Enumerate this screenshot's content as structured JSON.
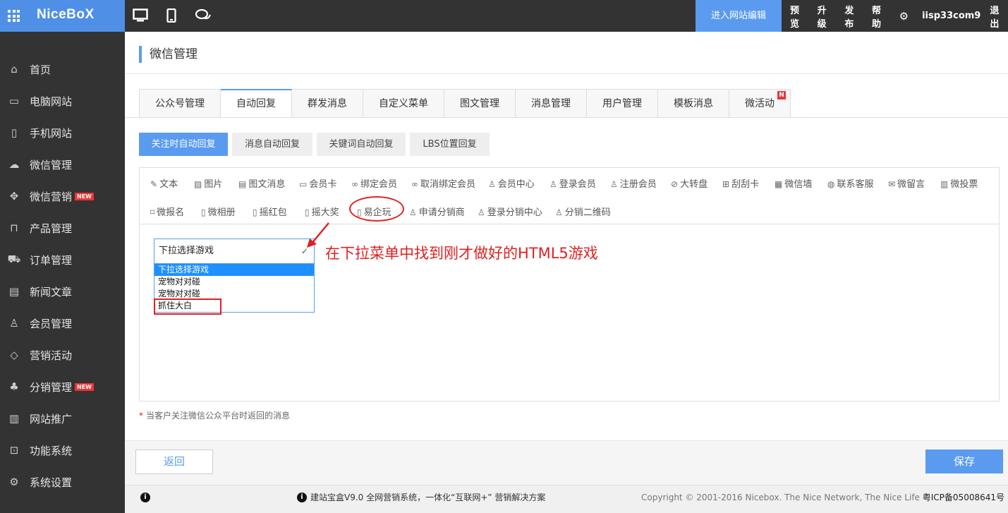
{
  "topbar": {
    "logo": "NiceBoX",
    "enter_edit": "进入网站编辑",
    "menu": [
      "预览",
      "升级",
      "发布",
      "帮助"
    ],
    "username": "iisp33com9",
    "logout": "退出"
  },
  "sidebar": {
    "items": [
      {
        "label": "首页",
        "icon": "home-icon"
      },
      {
        "label": "电脑网站",
        "icon": "monitor-icon"
      },
      {
        "label": "手机网站",
        "icon": "mobile-icon"
      },
      {
        "label": "微信管理",
        "icon": "chat-icon"
      },
      {
        "label": "微信营销",
        "icon": "gamepad-icon",
        "badge": "NEW"
      },
      {
        "label": "产品管理",
        "icon": "bag-icon"
      },
      {
        "label": "订单管理",
        "icon": "cart-icon"
      },
      {
        "label": "新闻文章",
        "icon": "document-icon"
      },
      {
        "label": "会员管理",
        "icon": "user-icon"
      },
      {
        "label": "营销活动",
        "icon": "tag-icon"
      },
      {
        "label": "分销管理",
        "icon": "sitemap-icon",
        "badge": "NEW"
      },
      {
        "label": "网站推广",
        "icon": "bar-chart-icon"
      },
      {
        "label": "功能系统",
        "icon": "toolbox-icon"
      },
      {
        "label": "系统设置",
        "icon": "gear-icon"
      }
    ]
  },
  "main": {
    "title": "微信管理",
    "tabs": [
      "公众号管理",
      "自动回复",
      "群发消息",
      "自定义菜单",
      "图文管理",
      "消息管理",
      "用户管理",
      "模板消息",
      "微活动"
    ],
    "tab_badge": "N",
    "subtabs": [
      "关注时自动回复",
      "消息自动回复",
      "关键词自动回复",
      "LBS位置回复"
    ],
    "tools_row1": [
      "文本",
      "图片",
      "图文消息",
      "会员卡",
      "绑定会员",
      "取消绑定会员",
      "会员中心",
      "登录会员",
      "注册会员",
      "大转盘",
      "刮刮卡",
      "微信墙",
      "联系客服",
      "微留言",
      "微投票"
    ],
    "tools_row2": [
      "微报名",
      "微相册",
      "摇红包",
      "摇大奖",
      "易企玩",
      "申请分销商",
      "登录分销中心",
      "分销二维码"
    ],
    "select_value": "下拉选择游戏",
    "options": [
      "下拉选择游戏",
      "宠物对对碰",
      "宠物对对碰",
      "抓住大白"
    ],
    "annotation": "在下拉菜单中找到刚才做好的HTML5游戏",
    "note": "当客户关注微信公众平台时返回的消息",
    "back_label": "返回",
    "save_label": "保存"
  },
  "footer": {
    "center": "建站宝盒V9.0 全网营销系统，一体化“互联网+” 营销解决方案",
    "copyright": "Copyright © 2001-2016 Nicebox. The Nice Network, The Nice Life",
    "icp": "粤ICP备05008641号"
  },
  "colors": {
    "accent": "#5a9bf0",
    "sidebar_bg": "#333333",
    "annotation": "#e02020"
  }
}
